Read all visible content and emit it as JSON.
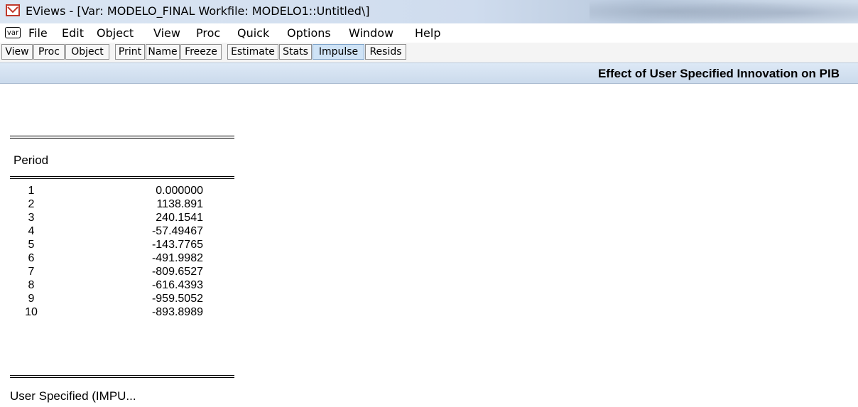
{
  "window": {
    "title": "EViews - [Var: MODELO_FINAL   Workfile: MODELO1::Untitled\\]",
    "icon": "eviews-app-icon"
  },
  "menubar": {
    "object_icon_label": "var",
    "items": [
      "File",
      "Edit",
      "Object",
      "View",
      "Proc",
      "Quick",
      "Options",
      "Window",
      "Help"
    ]
  },
  "toolbar": {
    "buttons": [
      "View",
      "Proc",
      "Object",
      "Print",
      "Name",
      "Freeze",
      "Estimate",
      "Stats",
      "Impulse",
      "Resids"
    ],
    "active": "Impulse"
  },
  "header": {
    "title": "Effect of User Specified Innovation on PIB"
  },
  "table": {
    "column_header": "Period",
    "rows": [
      {
        "period": "1",
        "value": "0.000000"
      },
      {
        "period": "2",
        "value": "1138.891"
      },
      {
        "period": "3",
        "value": "240.1541"
      },
      {
        "period": "4",
        "value": "-57.49467"
      },
      {
        "period": "5",
        "value": "-143.7765"
      },
      {
        "period": "6",
        "value": "-491.9982"
      },
      {
        "period": "7",
        "value": "-809.6527"
      },
      {
        "period": "8",
        "value": "-616.4393"
      },
      {
        "period": "9",
        "value": "-959.5052"
      },
      {
        "period": "10",
        "value": "-893.8989"
      }
    ],
    "footer": "User Specified (IMPU..."
  },
  "colors": {
    "active_button": "#cfe3f6",
    "header_strip": "#d6e3f2",
    "icon_red": "#c0392b"
  }
}
